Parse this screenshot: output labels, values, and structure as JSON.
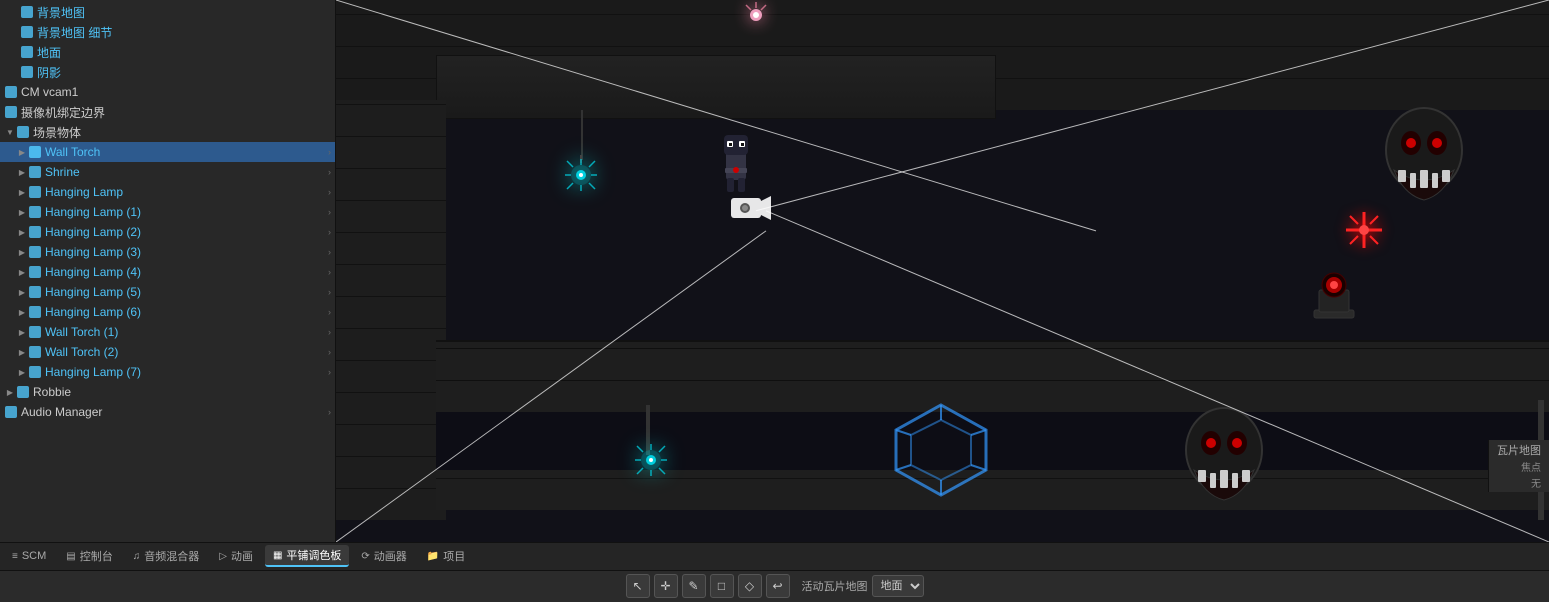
{
  "sidebar": {
    "items": [
      {
        "id": "bg-tilemap",
        "label": "背景地图",
        "icon": "cube",
        "indent": 1,
        "color": "blue",
        "expanded": false
      },
      {
        "id": "bg-tilemap-detail",
        "label": "背景地图 细节",
        "icon": "cube",
        "indent": 1,
        "color": "blue",
        "expanded": false
      },
      {
        "id": "ground",
        "label": "地面",
        "icon": "cube",
        "indent": 1,
        "color": "blue",
        "expanded": false
      },
      {
        "id": "shadow",
        "label": "阴影",
        "icon": "cube",
        "indent": 1,
        "color": "blue",
        "expanded": false
      },
      {
        "id": "cm-vcam1",
        "label": "CM vcam1",
        "icon": "cube",
        "indent": 0,
        "color": "blue",
        "expanded": false
      },
      {
        "id": "camera-bound",
        "label": "摄像机绑定边界",
        "icon": "cube",
        "indent": 0,
        "color": "blue",
        "expanded": false
      },
      {
        "id": "scene-objects",
        "label": "场景物体",
        "icon": "cube",
        "indent": 0,
        "color": "blue",
        "expanded": true
      },
      {
        "id": "wall-torch",
        "label": "Wall Torch",
        "icon": "cube",
        "indent": 1,
        "color": "blue",
        "selected": true,
        "hasArrow": true
      },
      {
        "id": "shrine",
        "label": "Shrine",
        "icon": "cube",
        "indent": 1,
        "color": "blue",
        "hasArrow": true
      },
      {
        "id": "hanging-lamp",
        "label": "Hanging Lamp",
        "icon": "cube",
        "indent": 1,
        "color": "blue",
        "hasArrow": true
      },
      {
        "id": "hanging-lamp-1",
        "label": "Hanging Lamp (1)",
        "icon": "cube",
        "indent": 1,
        "color": "blue",
        "hasArrow": true
      },
      {
        "id": "hanging-lamp-2",
        "label": "Hanging Lamp (2)",
        "icon": "cube",
        "indent": 1,
        "color": "blue",
        "hasArrow": true
      },
      {
        "id": "hanging-lamp-3",
        "label": "Hanging Lamp (3)",
        "icon": "cube",
        "indent": 1,
        "color": "blue",
        "hasArrow": true
      },
      {
        "id": "hanging-lamp-4",
        "label": "Hanging Lamp (4)",
        "icon": "cube",
        "indent": 1,
        "color": "blue",
        "hasArrow": true
      },
      {
        "id": "hanging-lamp-5",
        "label": "Hanging Lamp (5)",
        "icon": "cube",
        "indent": 1,
        "color": "blue",
        "hasArrow": true
      },
      {
        "id": "hanging-lamp-6",
        "label": "Hanging Lamp (6)",
        "icon": "cube",
        "indent": 1,
        "color": "blue",
        "hasArrow": true
      },
      {
        "id": "wall-torch-1",
        "label": "Wall Torch (1)",
        "icon": "cube",
        "indent": 1,
        "color": "blue",
        "hasArrow": true
      },
      {
        "id": "wall-torch-2",
        "label": "Wall Torch (2)",
        "icon": "cube",
        "indent": 1,
        "color": "blue",
        "hasArrow": true
      },
      {
        "id": "hanging-lamp-7",
        "label": "Hanging Lamp (7)",
        "icon": "cube",
        "indent": 1,
        "color": "blue",
        "hasArrow": true
      },
      {
        "id": "robbie",
        "label": "Robbie",
        "icon": "cube",
        "indent": 0,
        "color": "blue",
        "expanded": false
      },
      {
        "id": "audio-manager",
        "label": "Audio Manager",
        "icon": "cube",
        "indent": 0,
        "color": "blue",
        "hasArrow": true
      }
    ]
  },
  "toolbar": {
    "tabs": [
      {
        "id": "scm",
        "label": "SCM",
        "icon": "scm"
      },
      {
        "id": "console",
        "label": "控制台",
        "icon": "console"
      },
      {
        "id": "audio-mixer",
        "label": "音频混合器",
        "icon": "audio"
      },
      {
        "id": "animation",
        "label": "动画",
        "icon": "animation"
      },
      {
        "id": "tile-palette",
        "label": "平铺调色板",
        "icon": "palette",
        "active": true
      },
      {
        "id": "animator",
        "label": "动画器",
        "icon": "animator"
      },
      {
        "id": "project",
        "label": "项目",
        "icon": "project"
      }
    ],
    "tools": [
      {
        "id": "select",
        "symbol": "↖",
        "active": false
      },
      {
        "id": "move",
        "symbol": "✛",
        "active": false
      },
      {
        "id": "paint",
        "symbol": "✎",
        "active": false
      },
      {
        "id": "rect",
        "symbol": "□",
        "active": false
      },
      {
        "id": "pick",
        "symbol": "◇",
        "active": false
      },
      {
        "id": "erase",
        "symbol": "↩",
        "active": false
      }
    ],
    "active_tilemap_label": "活动瓦片地图",
    "active_tilemap_value": "地面",
    "focus_label": "焦点",
    "focus_value": "无",
    "tilemap_label": "瓦片地图"
  }
}
